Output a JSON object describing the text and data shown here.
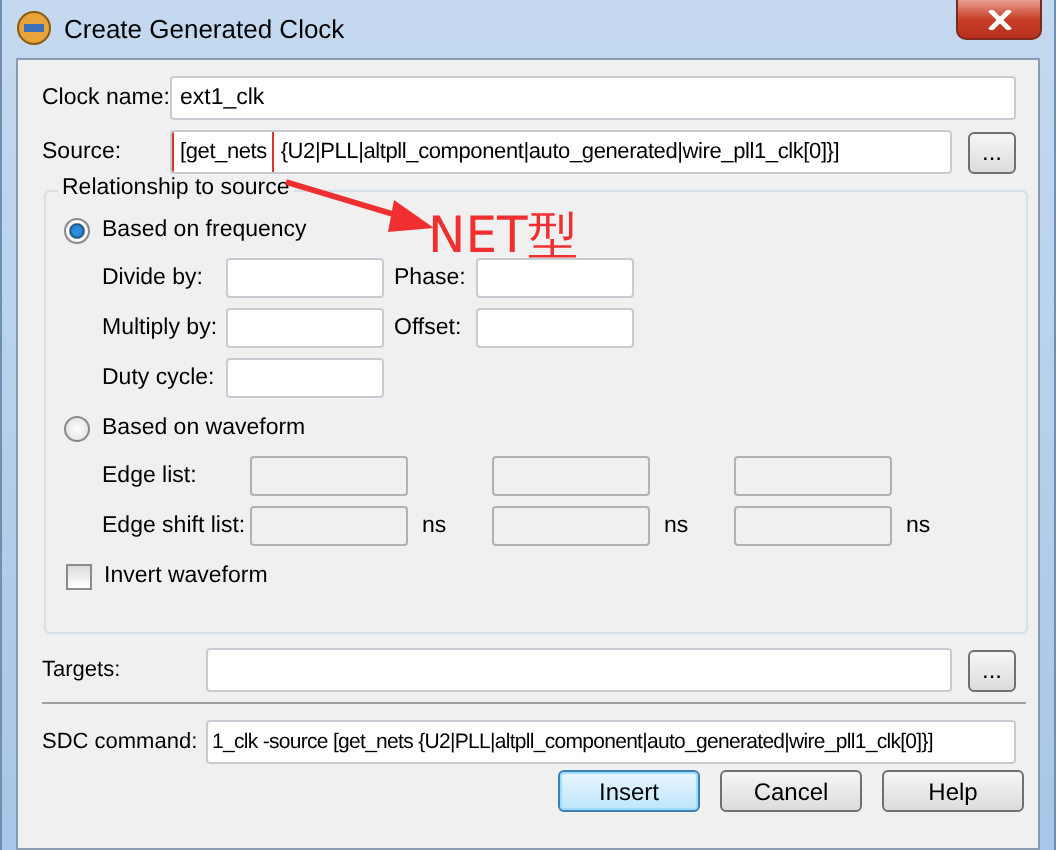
{
  "window": {
    "title": "Create Generated Clock"
  },
  "clock_name": {
    "label": "Clock name:",
    "value": "ext1_clk"
  },
  "source": {
    "label": "Source:",
    "value_highlighted": "[get_nets",
    "value_rest": " {U2|PLL|altpll_component|auto_generated|wire_pll1_clk[0]}]",
    "browse": "..."
  },
  "relationship": {
    "title": "Relationship to source",
    "options": [
      {
        "label": "Based on frequency",
        "selected": true
      },
      {
        "label": "Based on waveform",
        "selected": false
      }
    ],
    "frequency_fields": [
      {
        "label": "Divide by:"
      },
      {
        "label": "Phase:"
      },
      {
        "label": "Multiply by:"
      },
      {
        "label": "Offset:"
      },
      {
        "label": "Duty cycle:"
      }
    ],
    "waveform_rows": [
      {
        "label": "Edge list:",
        "disabled": true,
        "units": []
      },
      {
        "label": "Edge shift list:",
        "disabled": true,
        "units": [
          "ns",
          "ns",
          "ns"
        ]
      }
    ],
    "invert": {
      "label": "Invert waveform",
      "checked": false
    }
  },
  "targets": {
    "label": "Targets:",
    "browse": "..."
  },
  "sdc_command": {
    "label": "SDC command:",
    "value": "1_clk -source [get_nets {U2|PLL|altpll_component|auto_generated|wire_pll1_clk[0]}]"
  },
  "buttons": [
    {
      "label": "Insert",
      "focused": true
    },
    {
      "label": "Cancel",
      "focused": false
    },
    {
      "label": "Help",
      "focused": false
    }
  ],
  "annotation": {
    "text": "NET型"
  }
}
